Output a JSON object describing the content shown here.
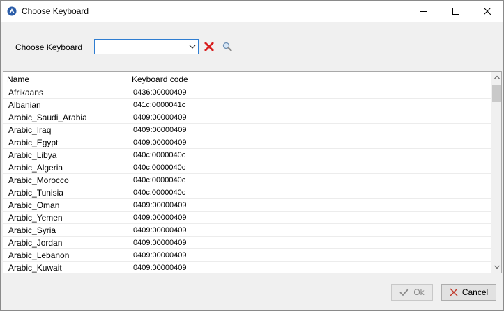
{
  "window": {
    "title": "Choose Keyboard"
  },
  "toolbar": {
    "label": "Choose Keyboard",
    "combo_value": ""
  },
  "table": {
    "columns": [
      "Name",
      "Keyboard code"
    ],
    "rows": [
      {
        "name": "Afrikaans",
        "code": "0436:00000409"
      },
      {
        "name": "Albanian",
        "code": "041c:0000041c"
      },
      {
        "name": "Arabic_Saudi_Arabia",
        "code": "0409:00000409"
      },
      {
        "name": "Arabic_Iraq",
        "code": "0409:00000409"
      },
      {
        "name": "Arabic_Egypt",
        "code": "0409:00000409"
      },
      {
        "name": "Arabic_Libya",
        "code": "040c:0000040c"
      },
      {
        "name": "Arabic_Algeria",
        "code": "040c:0000040c"
      },
      {
        "name": "Arabic_Morocco",
        "code": "040c:0000040c"
      },
      {
        "name": "Arabic_Tunisia",
        "code": "040c:0000040c"
      },
      {
        "name": "Arabic_Oman",
        "code": "0409:00000409"
      },
      {
        "name": "Arabic_Yemen",
        "code": "0409:00000409"
      },
      {
        "name": "Arabic_Syria",
        "code": "0409:00000409"
      },
      {
        "name": "Arabic_Jordan",
        "code": "0409:00000409"
      },
      {
        "name": "Arabic_Lebanon",
        "code": "0409:00000409"
      },
      {
        "name": "Arabic_Kuwait",
        "code": "0409:00000409"
      }
    ]
  },
  "footer": {
    "ok_label": "Ok",
    "cancel_label": "Cancel"
  },
  "icons": {
    "app": "keyboard-app-icon",
    "clear": "red-x-icon",
    "search": "magnifier-icon",
    "ok": "checkmark-icon",
    "cancel": "cross-icon"
  },
  "colors": {
    "clear_red": "#d81e1e",
    "combo_border": "#2f7dd1",
    "app_icon_blue": "#2a5ca8"
  }
}
